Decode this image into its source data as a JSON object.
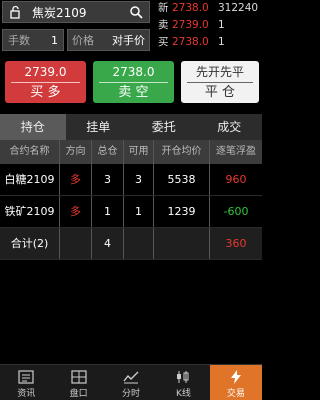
{
  "order": {
    "symbol": "焦炭2109",
    "qty_label": "手数",
    "qty_value": "1",
    "price_label": "价格",
    "price_value": "对手价"
  },
  "quotes": [
    {
      "k": "新",
      "v": "2738.0",
      "n": "312240"
    },
    {
      "k": "卖",
      "v": "2739.0",
      "n": "1"
    },
    {
      "k": "买",
      "v": "2738.0",
      "n": "1"
    }
  ],
  "actions": {
    "buy_price": "2739.0",
    "buy_label": "买 多",
    "sell_price": "2738.0",
    "sell_label": "卖 空",
    "close_priority": "先开先平",
    "close_label": "平 仓"
  },
  "tabs": [
    "持仓",
    "挂单",
    "委托",
    "成交"
  ],
  "table": {
    "headers": [
      "合约名称",
      "方向",
      "总仓",
      "可用",
      "开仓均价",
      "逐笔浮盈"
    ],
    "rows": [
      {
        "name": "白糖2109",
        "dir": "多",
        "total": "3",
        "avail": "3",
        "price": "5538",
        "pnl": "960"
      },
      {
        "name": "铁矿2109",
        "dir": "多",
        "total": "1",
        "avail": "1",
        "price": "1239",
        "pnl": "-600"
      }
    ],
    "sum_label": "合计(2)",
    "sum_total": "4",
    "sum_pnl": "360"
  },
  "nav": [
    "资讯",
    "盘口",
    "分时",
    "K线",
    "交易"
  ],
  "colors": {
    "red": "#e8392f",
    "green": "#2fc73b",
    "accent": "#e0752a"
  }
}
